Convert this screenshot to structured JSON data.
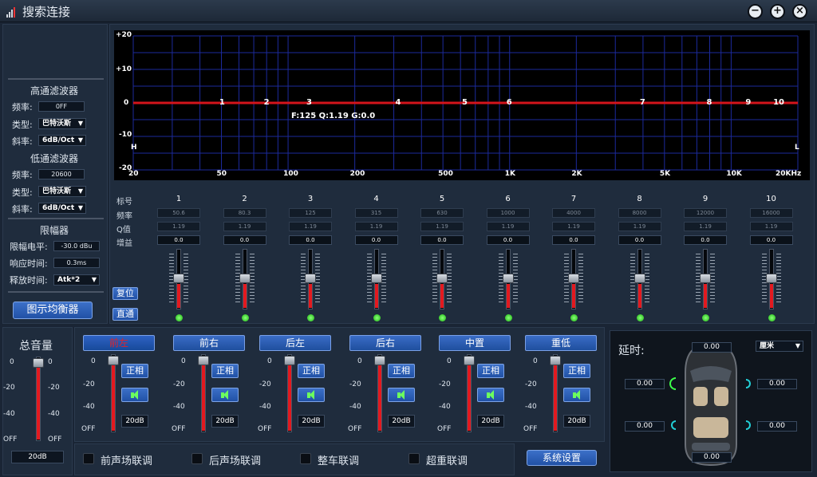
{
  "title": "搜索连接",
  "window_buttons": [
    "minimize",
    "maximize",
    "close"
  ],
  "left": {
    "hpf_title": "高通滤波器",
    "hpf": {
      "freq_label": "频率:",
      "freq": "0FF",
      "type_label": "类型:",
      "type": "巴特沃斯",
      "slope_label": "斜率:",
      "slope": "6dB/Oct"
    },
    "lpf_title": "低通滤波器",
    "lpf": {
      "freq_label": "频率:",
      "freq": "20600",
      "type_label": "类型:",
      "type": "巴特沃斯",
      "slope_label": "斜率:",
      "slope": "6dB/Oct"
    },
    "limiter_title": "限幅器",
    "limiter": {
      "level_label": "限幅电平:",
      "level": "-30.0 dBu",
      "attack_label": "响应时间:",
      "attack": "0.3ms",
      "release_label": "释放时间:",
      "release": "Atk*2"
    },
    "graphic_eq_button": "图示均衡器"
  },
  "graph": {
    "y_labels": [
      "+20",
      "+10",
      "0",
      "-10",
      "-20"
    ],
    "x_labels": [
      "20",
      "50",
      "100",
      "200",
      "500",
      "1K",
      "2K",
      "5K",
      "10K",
      "20KHz"
    ],
    "band_points": [
      "1",
      "2",
      "3",
      "4",
      "5",
      "6",
      "7",
      "8",
      "9",
      "10"
    ],
    "info": "F:125 Q:1.19 G:0.0",
    "h_marker": "H",
    "l_marker": "L"
  },
  "eq": {
    "row_labels": {
      "num": "标号",
      "freq": "频率",
      "q": "Q值",
      "gain": "增益"
    },
    "bands": [
      {
        "num": "1",
        "freq": "50.6",
        "q": "1.19",
        "gain": "0.0"
      },
      {
        "num": "2",
        "freq": "80.3",
        "q": "1.19",
        "gain": "0.0"
      },
      {
        "num": "3",
        "freq": "125",
        "q": "1.19",
        "gain": "0.0"
      },
      {
        "num": "4",
        "freq": "315",
        "q": "1.19",
        "gain": "0.0"
      },
      {
        "num": "5",
        "freq": "630",
        "q": "1.19",
        "gain": "0.0"
      },
      {
        "num": "6",
        "freq": "1000",
        "q": "1.19",
        "gain": "0.0"
      },
      {
        "num": "7",
        "freq": "4000",
        "q": "1.19",
        "gain": "0.0"
      },
      {
        "num": "8",
        "freq": "8000",
        "q": "1.19",
        "gain": "0.0"
      },
      {
        "num": "9",
        "freq": "12000",
        "q": "1.19",
        "gain": "0.0"
      },
      {
        "num": "10",
        "freq": "16000",
        "q": "1.19",
        "gain": "0.0"
      }
    ],
    "reset_button": "复位",
    "bypass_button": "直通"
  },
  "master": {
    "title": "总音量",
    "ticks": [
      "0",
      "-20",
      "-40",
      "OFF"
    ],
    "value": "20dB"
  },
  "channels": [
    {
      "name": "前左",
      "active": true,
      "phase": "正相",
      "db": "20dB"
    },
    {
      "name": "前右",
      "active": false,
      "phase": "正相",
      "db": "20dB"
    },
    {
      "name": "后左",
      "active": false,
      "phase": "正相",
      "db": "20dB"
    },
    {
      "name": "后右",
      "active": false,
      "phase": "正相",
      "db": "20dB"
    },
    {
      "name": "中置",
      "active": false,
      "phase": "正相",
      "db": "20dB"
    },
    {
      "name": "重低",
      "active": false,
      "phase": "正相",
      "db": "20dB"
    }
  ],
  "channel_ticks": [
    "0",
    "-20",
    "-40",
    "OFF"
  ],
  "links": [
    "前声场联调",
    "后声场联调",
    "整车联调",
    "超重联调"
  ],
  "system_button": "系统设置",
  "delay": {
    "title": "延时:",
    "unit": "厘米",
    "top": "0.00",
    "front_left": "0.00",
    "front_right": "0.00",
    "rear_left": "0.00",
    "rear_right": "0.00",
    "sub": "0.00"
  }
}
